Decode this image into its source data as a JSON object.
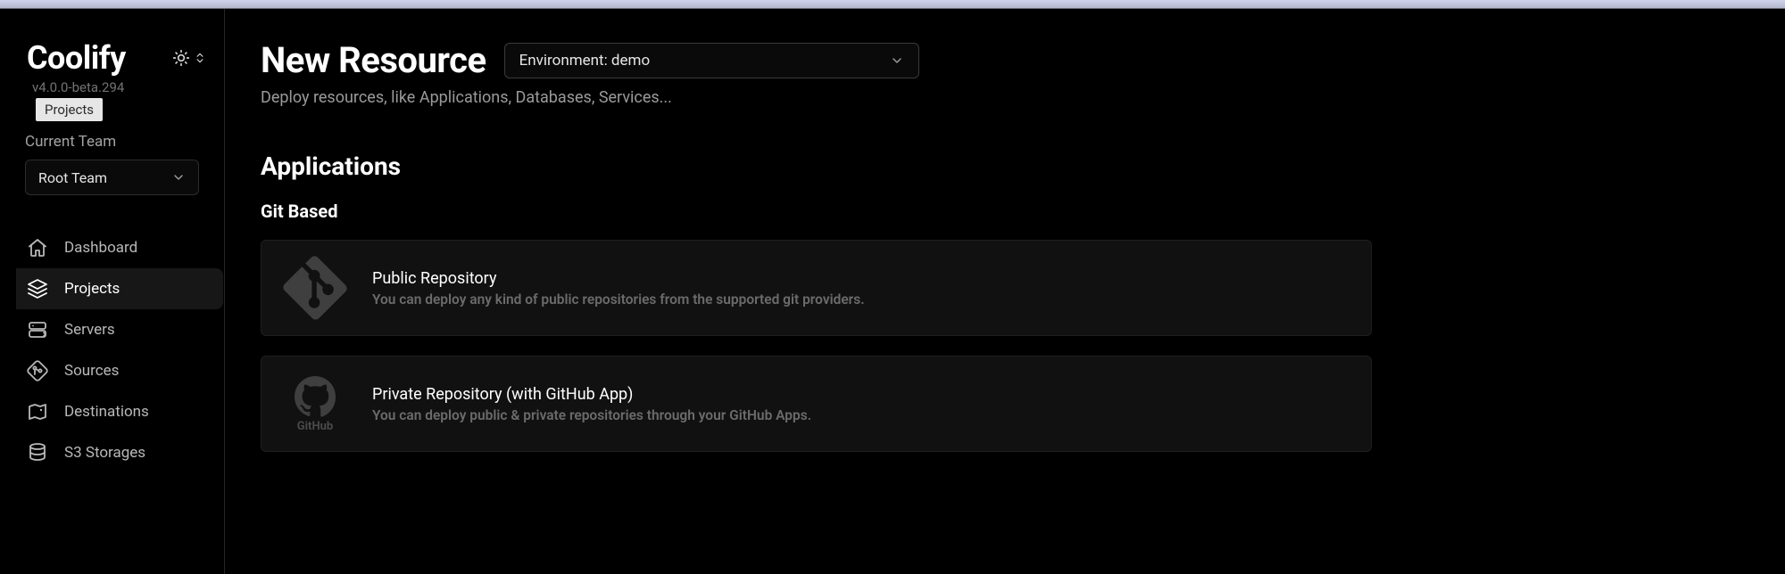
{
  "brand": "Coolify",
  "version": "v4.0.0-beta.294",
  "tooltip": "Projects",
  "team": {
    "label": "Current Team",
    "value": "Root Team"
  },
  "nav": {
    "dashboard": "Dashboard",
    "projects": "Projects",
    "servers": "Servers",
    "sources": "Sources",
    "destinations": "Destinations",
    "s3storages": "S3 Storages"
  },
  "page": {
    "title": "New Resource",
    "subtitle": "Deploy resources, like Applications, Databases, Services...",
    "env_label": "Environment: demo"
  },
  "applications": {
    "heading": "Applications",
    "git_based": "Git Based",
    "cards": [
      {
        "title": "Public Repository",
        "desc": "You can deploy any kind of public repositories from the supported git providers."
      },
      {
        "title": "Private Repository (with GitHub App)",
        "desc": "You can deploy public & private repositories through your GitHub Apps."
      }
    ]
  },
  "github_word": "GitHub"
}
